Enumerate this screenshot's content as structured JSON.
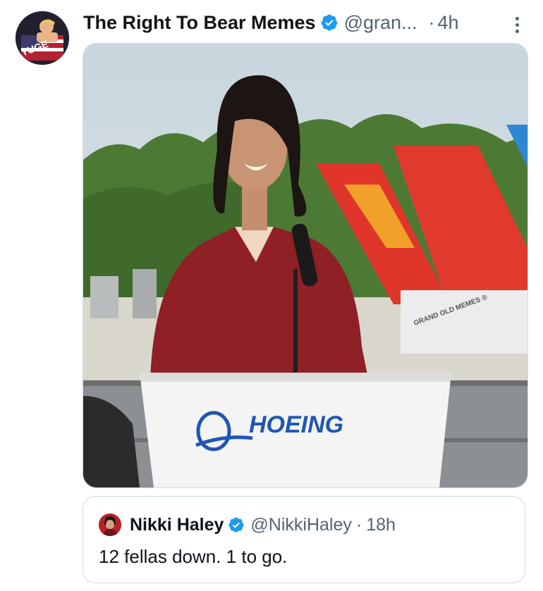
{
  "post": {
    "author": {
      "display_name": "The Right To Bear Memes",
      "handle": "@gran...",
      "verified": true,
      "avatar_text": "YUGE"
    },
    "separator": "·",
    "time": "4h",
    "more_icon": "more-vertical-icon",
    "media": {
      "podium_logo_text": "HOEING",
      "watermark_text": "GRAND OLD MEMES ®"
    },
    "quoted": {
      "display_name": "Nikki Haley",
      "handle": "@NikkiHaley",
      "verified": true,
      "separator": "·",
      "time": "18h",
      "text": "12 fellas down. 1 to go."
    }
  },
  "colors": {
    "verified_blue": "#1d9bf0",
    "secondary_text": "#536471",
    "border": "#cfd9de"
  }
}
